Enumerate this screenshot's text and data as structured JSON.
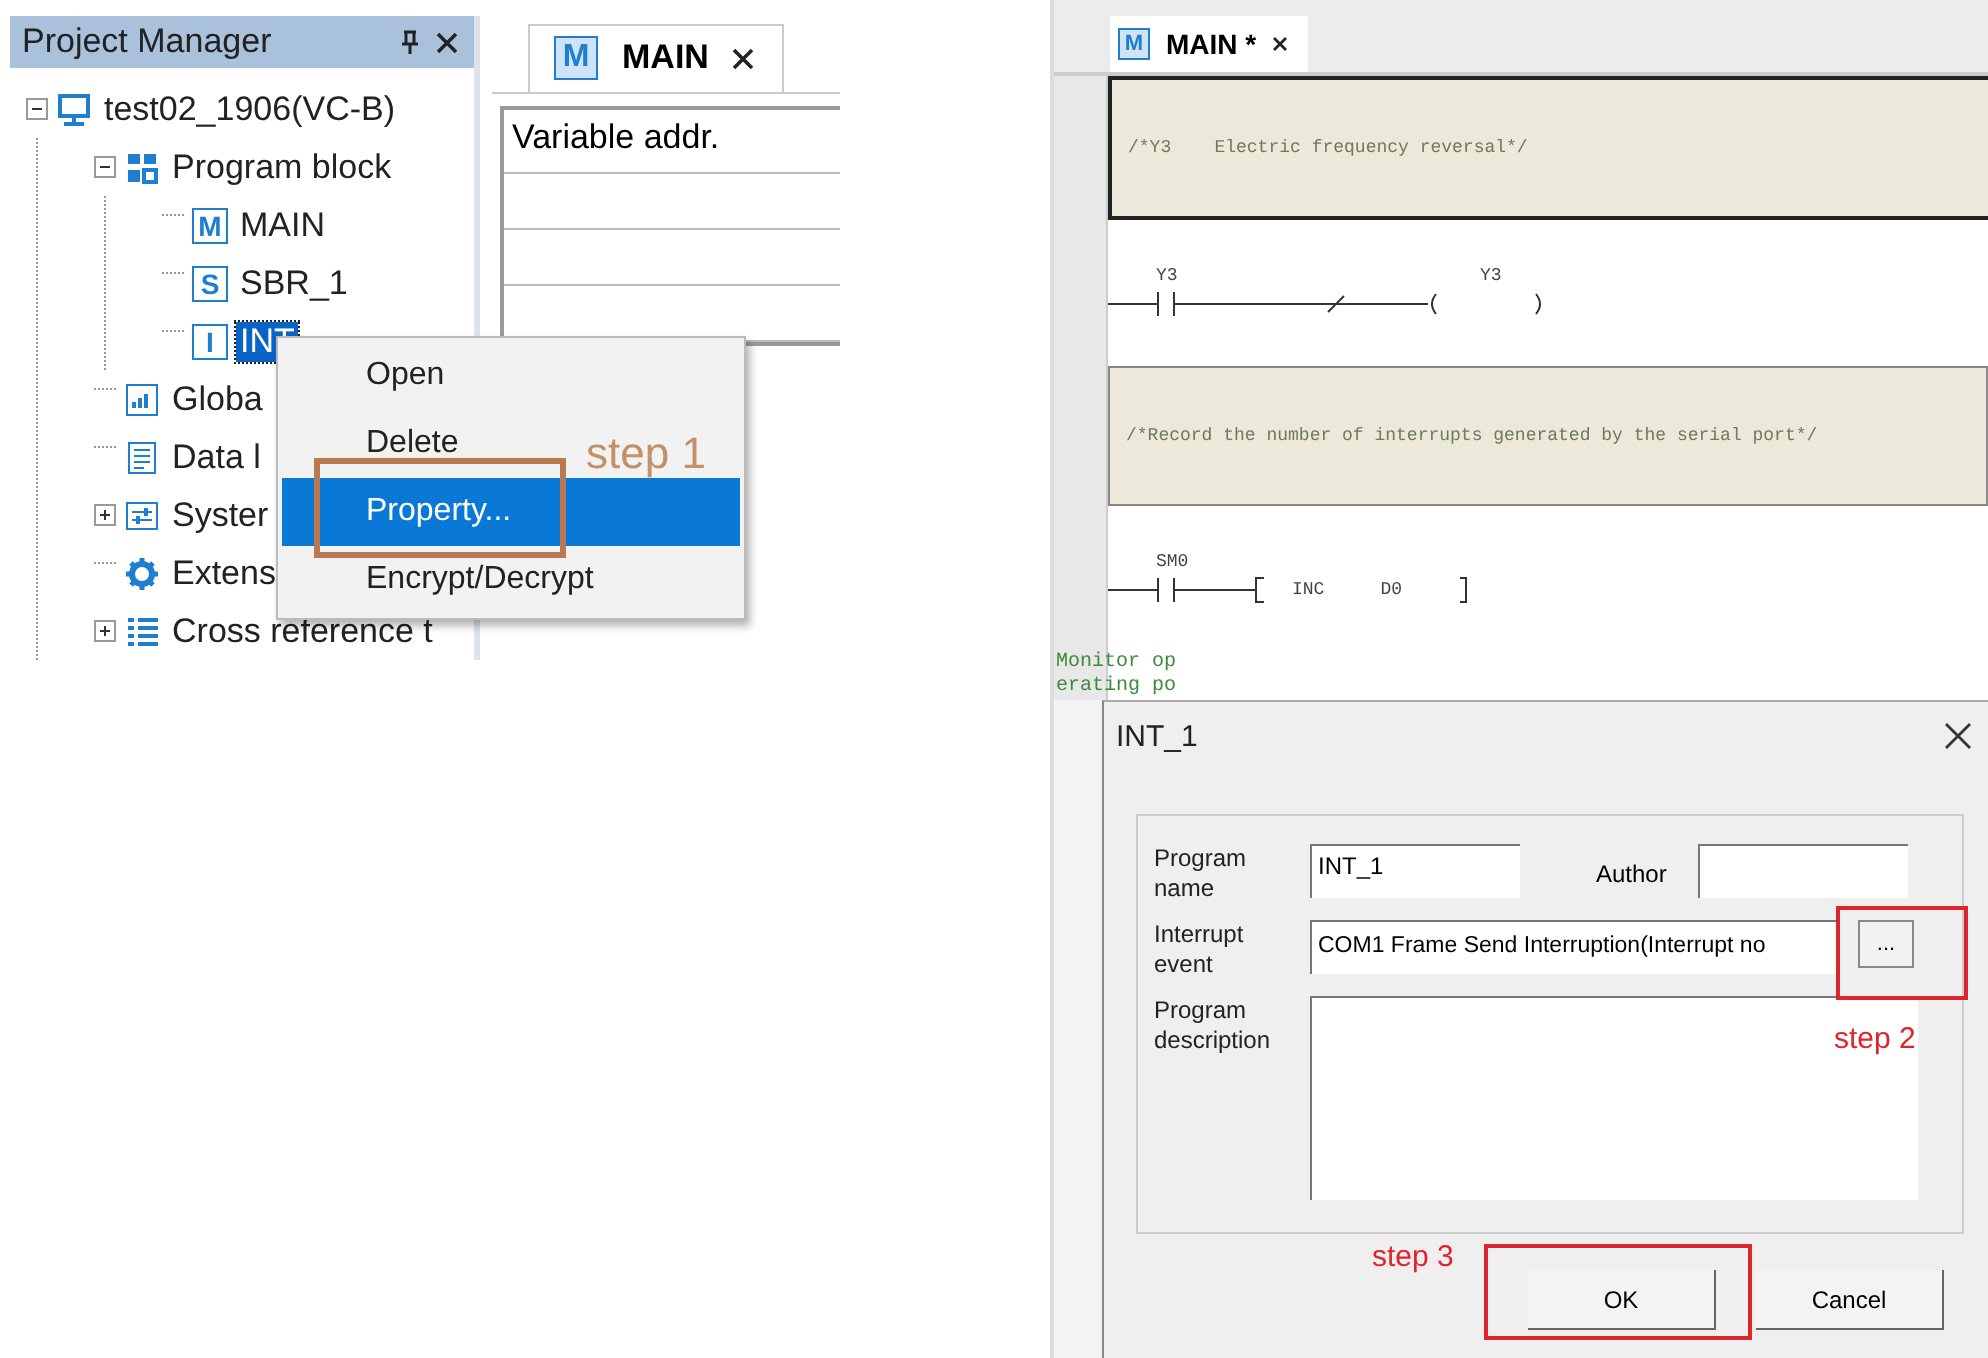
{
  "project_manager": {
    "title": "Project Manager",
    "tree": [
      {
        "label": "test02_1906(VC-B)",
        "kind": "computer",
        "expanded": true,
        "selected": false,
        "children": [
          {
            "label": "Program block",
            "kind": "blocks",
            "expanded": true,
            "selected": false,
            "children": [
              {
                "label": "MAIN",
                "kind": "letter",
                "badge": "M",
                "selected": false
              },
              {
                "label": "SBR_1",
                "kind": "letter",
                "badge": "S",
                "selected": false
              },
              {
                "label": "INT",
                "kind": "letter",
                "badge": "I",
                "selected": true
              }
            ]
          },
          {
            "label": "Globa",
            "kind": "chart",
            "selected": false
          },
          {
            "label": "Data l",
            "kind": "document",
            "selected": false
          },
          {
            "label": "Syster",
            "kind": "settings",
            "expanded": false,
            "selected": false
          },
          {
            "label": "Extens",
            "kind": "gear",
            "selected": false
          },
          {
            "label": "Cross reference t",
            "kind": "list",
            "expanded": false,
            "selected": false
          }
        ]
      }
    ]
  },
  "editor_left": {
    "tab": {
      "badge": "M",
      "label": "MAIN"
    },
    "table_header": "Variable addr."
  },
  "context_menu": [
    {
      "label": "Open",
      "selected": false
    },
    {
      "label": "Delete",
      "selected": false
    },
    {
      "label": "Property...",
      "selected": true
    },
    {
      "label": "Encrypt/Decrypt",
      "selected": false
    }
  ],
  "step_labels": [
    "step 1",
    "step 2",
    "step 3"
  ],
  "editor_right": {
    "tab": {
      "badge": "M",
      "label": "MAIN *"
    },
    "networks": [
      {
        "kind": "comment",
        "text": "/*Y3    Electric frequency reversal*/"
      },
      {
        "kind": "rung",
        "elements": [
          {
            "kind": "contact",
            "label": "Y3"
          },
          {
            "kind": "invert"
          },
          {
            "kind": "coil",
            "label": "Y3"
          }
        ]
      },
      {
        "kind": "comment",
        "text": "/*Record the number of interrupts generated by the serial port*/"
      },
      {
        "kind": "rung",
        "elements": [
          {
            "kind": "contact",
            "label": "SM0"
          },
          {
            "kind": "box",
            "op": "INC",
            "operand": "D0"
          }
        ]
      }
    ],
    "note_lines": [
      "Monitor op",
      "erating po"
    ]
  },
  "dialog": {
    "title": "INT_1",
    "program_name_label": "Program name",
    "program_name": "INT_1",
    "author_label": "Author",
    "interrupt_event_label": "Interrupt event",
    "interrupt_event": "COM1 Frame Send Interruption(Interrupt no",
    "browse_button": "...",
    "description_label": "Program description",
    "buttons": [
      "OK",
      "Cancel"
    ]
  }
}
